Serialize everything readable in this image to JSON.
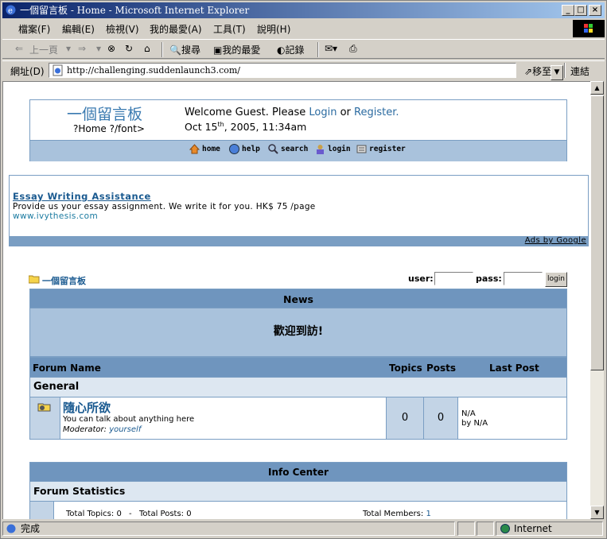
{
  "window": {
    "title": "一個留言板 - Home - Microsoft Internet Explorer"
  },
  "menu": [
    "檔案(F)",
    "編輯(E)",
    "檢視(V)",
    "我的最愛(A)",
    "工具(T)",
    "說明(H)"
  ],
  "toolbar": {
    "back": "上一頁",
    "search": "搜尋",
    "favorites": "我的最愛",
    "history": "記錄"
  },
  "address": {
    "label": "網址(D)",
    "url": "http://challenging.suddenlaunch3.com/",
    "go": "移至",
    "links": "連結"
  },
  "status": {
    "text": "完成",
    "zone": "Internet"
  },
  "header": {
    "site_name": "一個留言板",
    "site_sub": "?Home ?/font>",
    "welcome_pre": "Welcome Guest. Please ",
    "login_link": "Login",
    "or": " or ",
    "register_link": "Register.",
    "date_pre": "Oct 15",
    "date_sup": "th",
    "date_post": ", 2005, 11:34am",
    "nav": {
      "home": "home",
      "help": "help",
      "search": "search",
      "login": "login",
      "register": "register"
    }
  },
  "ad": {
    "title": "Essay Writing Assistance",
    "desc": "Provide us your essay assignment. We write it for you. HK$ 75 /page",
    "url": "www.ivythesis.com",
    "by": "Ads by Google"
  },
  "breadcrumb": "一個留言板",
  "login_form": {
    "user_label": "user:",
    "pass_label": "pass:",
    "button": "login"
  },
  "news": {
    "heading": "News",
    "body": "歡迎到訪!"
  },
  "forum_table": {
    "headers": {
      "name": "Forum Name",
      "topics": "Topics",
      "posts": "Posts",
      "last": "Last Post"
    },
    "category": "General",
    "forum": {
      "name": "隨心所欲",
      "desc": "You can talk about anything here",
      "mod_label": "Moderator: ",
      "mod_name": "yourself",
      "topics": "0",
      "posts": "0",
      "last_line1": "N/A",
      "last_line2": "by N/A"
    }
  },
  "info": {
    "heading": "Info Center",
    "stats_heading": "Forum Statistics",
    "total_topics": "Total Topics: 0",
    "dash": "-",
    "total_posts": "Total Posts: 0",
    "total_members_label": "Total Members: ",
    "total_members": "1"
  },
  "colors": {
    "header_blue": "#6f95be",
    "light_blue": "#a9c2dc",
    "link": "#1a5a90"
  }
}
